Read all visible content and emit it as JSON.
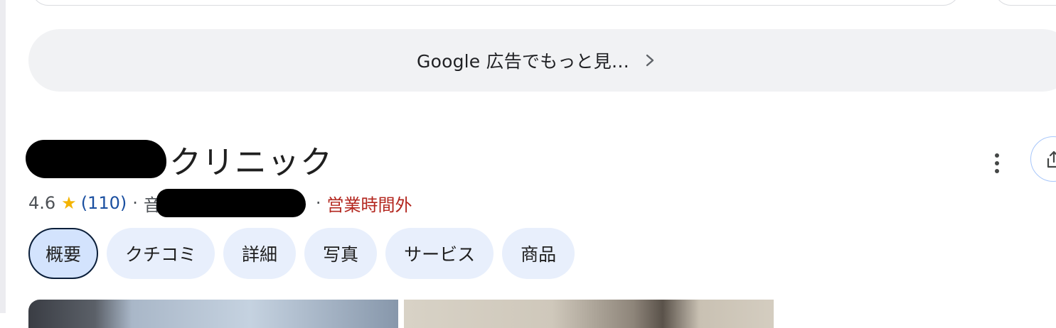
{
  "more_ads": {
    "label": "Google 広告でもっと見…"
  },
  "business": {
    "name_suffix": "クリニック",
    "rating": "4.6",
    "star": "★",
    "review_count": "(110)",
    "separator": "·",
    "category_prefix": "音",
    "hours_status": "営業時間外"
  },
  "tabs": [
    {
      "label": "概要",
      "active": true
    },
    {
      "label": "クチコミ"
    },
    {
      "label": "詳細"
    },
    {
      "label": "写真"
    },
    {
      "label": "サービス"
    },
    {
      "label": "商品"
    }
  ],
  "icons": {
    "more_ads": "chevron-right-icon",
    "options": "more-vert-icon",
    "share": "share-icon"
  },
  "colors": {
    "hours_closed": "#b3261e",
    "review_link": "#1a4fa0",
    "star": "#f4b400",
    "tab_bg": "#e8effc",
    "tab_active_bg": "#d3e3fd"
  }
}
